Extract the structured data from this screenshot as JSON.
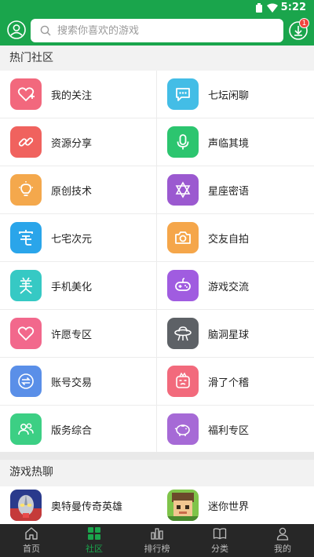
{
  "status": {
    "time": "5:22"
  },
  "header": {
    "search_placeholder": "搜索你喜欢的游戏",
    "download_badge": "1"
  },
  "hot_section": {
    "title": "热门社区",
    "items": [
      {
        "label": "我的关注",
        "icon": "heart-plus-icon",
        "color": "#f2687d"
      },
      {
        "label": "七坛闲聊",
        "icon": "chat-bubble-icon",
        "color": "#43bde6"
      },
      {
        "label": "资源分享",
        "icon": "link-icon",
        "color": "#f0625e"
      },
      {
        "label": "声临其境",
        "icon": "microphone-icon",
        "color": "#2cc56f"
      },
      {
        "label": "原创技术",
        "icon": "lightbulb-icon",
        "color": "#f4a84c"
      },
      {
        "label": "星座密语",
        "icon": "star-of-david-icon",
        "color": "#9b59d0"
      },
      {
        "label": "七宅次元",
        "icon": "zhai-character-icon",
        "color": "#2aa5ea"
      },
      {
        "label": "交友自拍",
        "icon": "camera-icon",
        "color": "#f5a64a"
      },
      {
        "label": "手机美化",
        "icon": "mei-character-icon",
        "color": "#36c9c4"
      },
      {
        "label": "游戏交流",
        "icon": "gamepad-icon",
        "color": "#a05ce0"
      },
      {
        "label": "许愿专区",
        "icon": "heart-outline-icon",
        "color": "#f2688c"
      },
      {
        "label": "脑洞星球",
        "icon": "ufo-icon",
        "color": "#5d6166"
      },
      {
        "label": "账号交易",
        "icon": "exchange-icon",
        "color": "#5a8fe8"
      },
      {
        "label": "滑了个稽",
        "icon": "funny-face-icon",
        "color": "#f26a7c"
      },
      {
        "label": "版务综合",
        "icon": "group-icon",
        "color": "#3ccf84"
      },
      {
        "label": "福利专区",
        "icon": "piggy-bank-icon",
        "color": "#a66ad6"
      }
    ]
  },
  "games_section": {
    "title": "游戏热聊",
    "items": [
      {
        "label": "奥特曼传奇英雄",
        "icon": "ultraman-game-icon"
      },
      {
        "label": "迷你世界",
        "icon": "mini-world-game-icon"
      }
    ]
  },
  "nav": [
    {
      "label": "首页",
      "icon": "home-icon",
      "active": false
    },
    {
      "label": "社区",
      "icon": "community-grid-icon",
      "active": true
    },
    {
      "label": "排行榜",
      "icon": "ranking-icon",
      "active": false
    },
    {
      "label": "分类",
      "icon": "book-icon",
      "active": false
    },
    {
      "label": "我的",
      "icon": "person-icon",
      "active": false
    }
  ],
  "colors": {
    "accent": "#1aa54c",
    "nav_bg": "#272727",
    "badge": "#f0433d"
  }
}
